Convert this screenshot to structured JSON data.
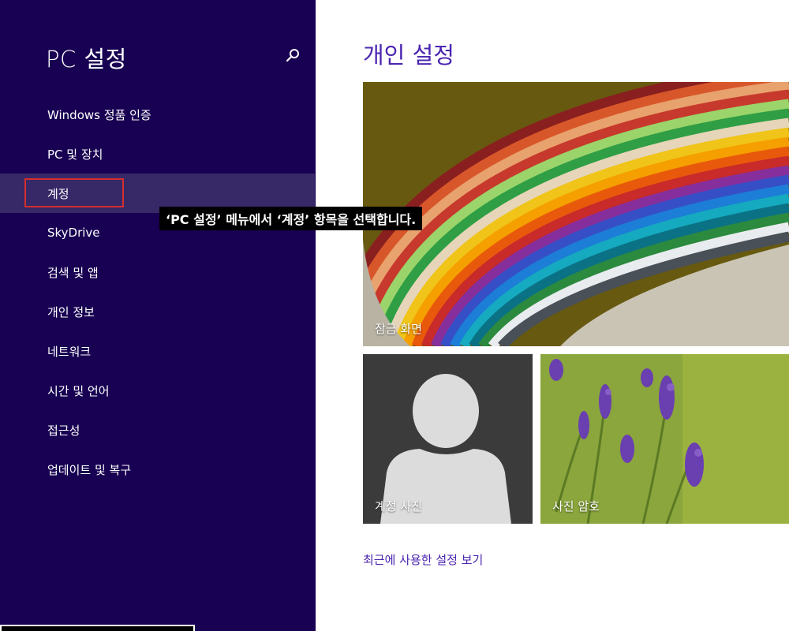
{
  "sidebar": {
    "title": "PC 설정",
    "search_icon": "search-icon",
    "items": [
      {
        "label": "Windows 정품 인증"
      },
      {
        "label": "PC 및 장치"
      },
      {
        "label": "계정"
      },
      {
        "label": "SkyDrive"
      },
      {
        "label": "검색 및 앱"
      },
      {
        "label": "개인 정보"
      },
      {
        "label": "네트워크"
      },
      {
        "label": "시간 및 언어"
      },
      {
        "label": "접근성"
      },
      {
        "label": "업데이트 및 복구"
      }
    ],
    "selected": "계정"
  },
  "main": {
    "title": "개인 설정",
    "tiles": {
      "lock_screen": {
        "label": "잠금 화면"
      },
      "account_picture": {
        "label": "계정 사진"
      },
      "picture_password": {
        "label": "사진 암호"
      }
    },
    "recent_link": "최근에 사용한 설정 보기"
  },
  "callout": {
    "text": "‘PC 설정’ 메뉴에서 ‘계정’ 항목을 선택합니다."
  },
  "colors": {
    "sidebar_bg": "#180052",
    "selected_bg": "#372867",
    "accent": "#4a25b0",
    "highlight": "#d32f2f"
  }
}
